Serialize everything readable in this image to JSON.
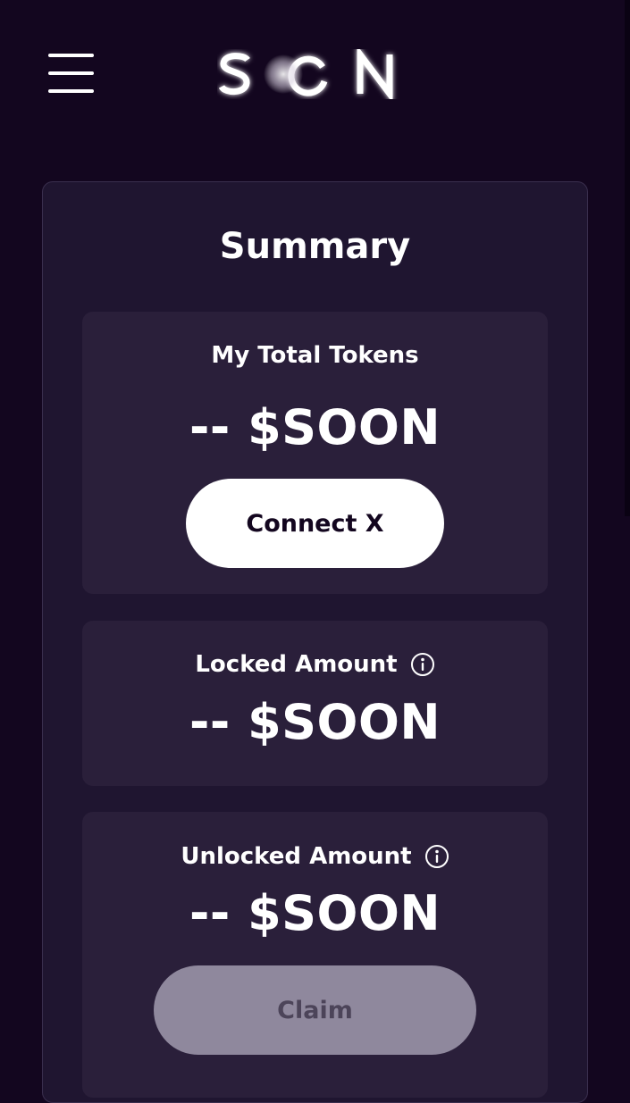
{
  "header": {
    "menu_icon": "hamburger-menu-icon",
    "logo_text": "SOON"
  },
  "summary": {
    "title": "Summary",
    "total_tokens": {
      "label": "My Total Tokens",
      "amount": "-- $SOON",
      "button_label": "Connect X"
    },
    "locked": {
      "label": "Locked Amount",
      "amount": "-- $SOON",
      "info_icon": "info-icon"
    },
    "unlocked": {
      "label": "Unlocked Amount",
      "amount": "-- $SOON",
      "info_icon": "info-icon",
      "button_label": "Claim",
      "button_disabled": true
    }
  },
  "colors": {
    "background": "#13061f",
    "card": "#1f1530",
    "panel": "#2a1f3a",
    "text": "#ffffff",
    "button_primary": "#ffffff",
    "button_disabled": "#8f889d"
  }
}
